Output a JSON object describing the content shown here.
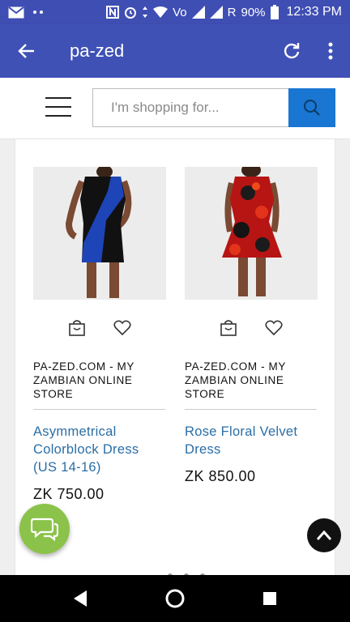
{
  "status_bar": {
    "carrier_indicator": "R",
    "battery": "90%",
    "time": "12:33 PM",
    "volte": "Vo",
    "icons": [
      "mail-icon",
      "dots-icon",
      "nfc-icon",
      "alarm-icon",
      "data-arrows-icon",
      "wifi-icon",
      "volte-icon",
      "signal-icon",
      "signal-icon",
      "battery-icon"
    ]
  },
  "app_bar": {
    "title": "pa-zed",
    "background": "#3f51b5"
  },
  "search": {
    "placeholder": "I'm shopping for...",
    "button_color": "#1976d2"
  },
  "products": [
    {
      "store": "PA-ZED.COM - MY ZAMBIAN ONLINE STORE",
      "title": "Asymmetrical Colorblock Dress (US 14-16)",
      "price": "ZK 750.00"
    },
    {
      "store": "PA-ZED.COM - MY ZAMBIAN ONLINE STORE",
      "title": "Rose Floral Velvet Dress",
      "price": "ZK 850.00"
    }
  ],
  "colors": {
    "link": "#2a6ea6",
    "chat_fab": "#8bc34a",
    "top_fab": "#111111"
  }
}
